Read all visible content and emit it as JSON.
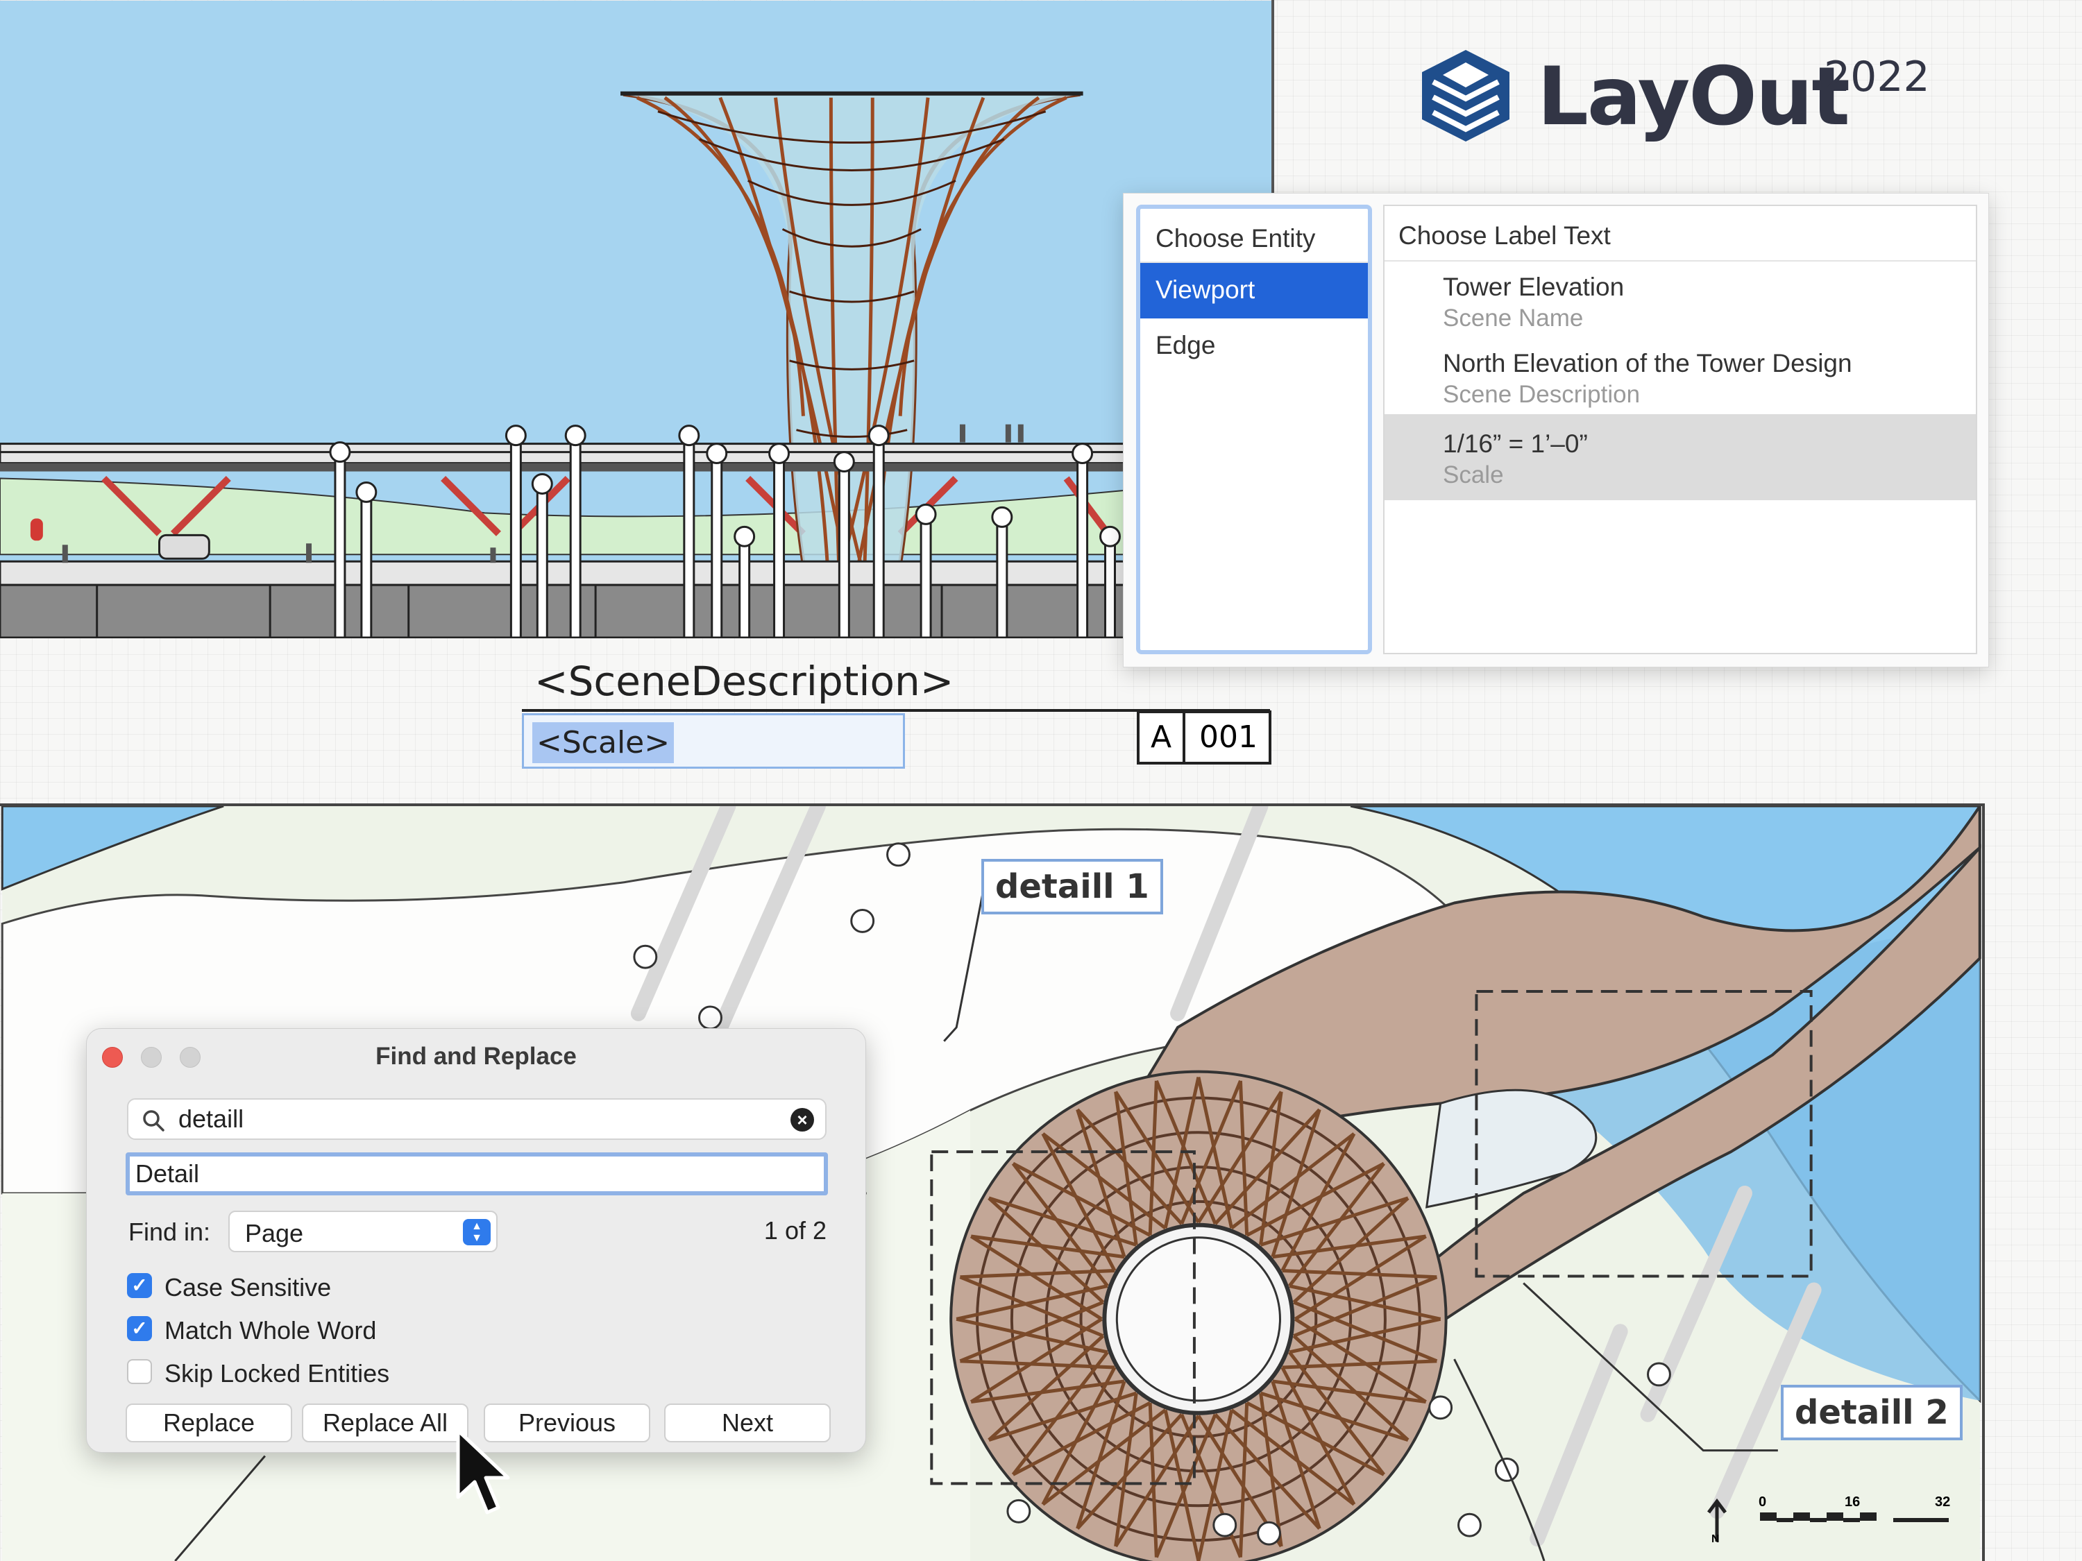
{
  "brand": {
    "name": "LayOut",
    "year": "2022",
    "logo_icon": "layout-stack-logo"
  },
  "label_popup": {
    "entity_header": "Choose Entity",
    "entities": [
      {
        "label": "Viewport",
        "selected": true
      },
      {
        "label": "Edge",
        "selected": false
      }
    ],
    "label_text_header": "Choose Label Text",
    "options": [
      {
        "value": "Tower Elevation",
        "key": "Scene Name",
        "selected": false
      },
      {
        "value": "North Elevation of the Tower Design",
        "key": "Scene Description",
        "selected": false
      },
      {
        "value": "1/16” = 1’–0”",
        "key": "Scale",
        "selected": true
      }
    ]
  },
  "title_block": {
    "scene_description": "<SceneDescription>",
    "scale": "<Scale>",
    "sheet_letter": "A",
    "sheet_number": "001"
  },
  "plan": {
    "tag_1": "detaill 1",
    "tag_2": "detaill 2",
    "north_label": "N",
    "scale_ticks": [
      "0",
      "16",
      "32"
    ]
  },
  "find_replace": {
    "title": "Find and Replace",
    "search_value": "detaill",
    "replace_value": "Detail",
    "find_in_label": "Find in:",
    "find_in_value": "Page",
    "match_count": "1 of 2",
    "options": {
      "case_sensitive": {
        "label": "Case Sensitive",
        "checked": true
      },
      "match_whole_word": {
        "label": "Match Whole Word",
        "checked": true
      },
      "skip_locked": {
        "label": "Skip Locked Entities",
        "checked": false
      }
    },
    "buttons": {
      "replace": "Replace",
      "replace_all": "Replace All",
      "previous": "Previous",
      "next": "Next"
    }
  },
  "colors": {
    "selection_blue": "#2264d8",
    "sky": "#a6d4f0",
    "water": "#8ac8ef",
    "walkway": "#c3a797",
    "brand_navy": "#1f4e8c"
  }
}
